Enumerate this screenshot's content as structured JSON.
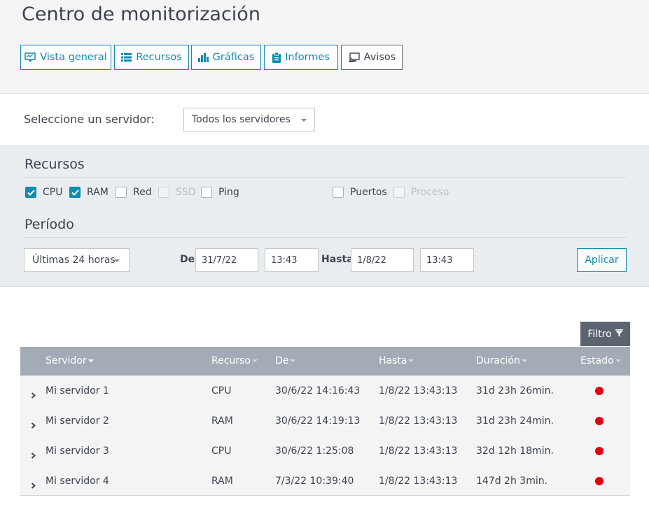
{
  "header": {
    "title": "Centro de monitorización",
    "tabs": [
      {
        "label": "Vista general",
        "icon": "monitor-icon"
      },
      {
        "label": "Recursos",
        "icon": "list-icon"
      },
      {
        "label": "Gráficas",
        "icon": "bar-chart-icon"
      },
      {
        "label": "Informes",
        "icon": "clipboard-icon"
      },
      {
        "label": "Avisos",
        "icon": "alert-monitor-icon"
      }
    ]
  },
  "server": {
    "label": "Seleccione un servidor:",
    "selected": "Todos los servidores"
  },
  "resources": {
    "title": "Recursos",
    "items": [
      {
        "label": "CPU",
        "checked": true,
        "disabled": false
      },
      {
        "label": "RAM",
        "checked": true,
        "disabled": false
      },
      {
        "label": "Red",
        "checked": false,
        "disabled": false
      },
      {
        "label": "SSD",
        "checked": false,
        "disabled": true
      },
      {
        "label": "Ping",
        "checked": false,
        "disabled": false
      },
      {
        "label": "Puertos",
        "checked": false,
        "disabled": false
      },
      {
        "label": "Proceso",
        "checked": false,
        "disabled": true
      }
    ]
  },
  "period": {
    "title": "Período",
    "selected": "Últimas 24 horas",
    "from_label": "De",
    "from_date": "31/7/22",
    "from_time": "13:43",
    "to_label": "Hasta",
    "to_date": "1/8/22",
    "to_time": "13:43",
    "apply": "Aplicar"
  },
  "table": {
    "filter_label": "Filtro",
    "columns": [
      "Servidor",
      "Recurso",
      "De",
      "Hasta",
      "Duración",
      "Estado"
    ],
    "rows": [
      {
        "server": "Mi servidor 1",
        "resource": "CPU",
        "from": "30/6/22 14:16:43",
        "to": "1/8/22 13:43:13",
        "duration": "31d 23h 26min.",
        "status": "red"
      },
      {
        "server": "Mi servidor 2",
        "resource": "RAM",
        "from": "30/6/22 14:19:13",
        "to": "1/8/22 13:43:13",
        "duration": "31d 23h 24min.",
        "status": "red"
      },
      {
        "server": "Mi servidor 3",
        "resource": "CPU",
        "from": "30/6/22 1:25:08",
        "to": "1/8/22 13:43:13",
        "duration": "32d 12h 18min.",
        "status": "red"
      },
      {
        "server": "Mi servidor 4",
        "resource": "RAM",
        "from": "7/3/22 10:39:40",
        "to": "1/8/22 13:43:13",
        "duration": "147d 2h 3min.",
        "status": "red"
      }
    ]
  },
  "colors": {
    "accent": "#0f8ab3",
    "status_red": "#e0000f",
    "table_header": "#a3acb6"
  }
}
